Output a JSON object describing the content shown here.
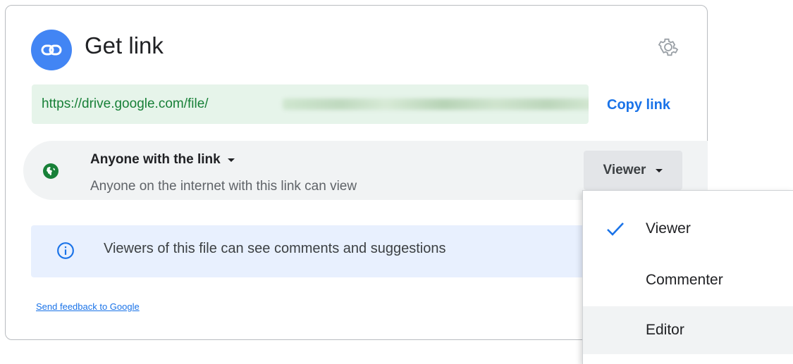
{
  "dialog": {
    "title": "Get link",
    "header_icon": "link-icon",
    "settings_icon": "gear-icon"
  },
  "link": {
    "url_visible": "https://drive.google.com/file/",
    "ellipsis": "..",
    "copy_label": "Copy link"
  },
  "access": {
    "scope_label": "Anyone with the link",
    "description": "Anyone on the internet with this link can view",
    "icon": "globe-icon",
    "role_label": "Viewer"
  },
  "info": {
    "icon": "info-icon",
    "text": "Viewers of this file can see comments and suggestions"
  },
  "feedback_label": "Send feedback to Google",
  "role_menu": {
    "items": [
      {
        "label": "Viewer",
        "selected": true
      },
      {
        "label": "Commenter",
        "selected": false
      },
      {
        "label": "Editor",
        "selected": false,
        "hovered": true
      }
    ]
  },
  "colors": {
    "accent": "#1a73e8",
    "header_icon_bg": "#4285f4",
    "link_bg": "#e6f4ea",
    "link_text": "#188038",
    "globe": "#188038",
    "info_bg": "#e8f0fe"
  }
}
